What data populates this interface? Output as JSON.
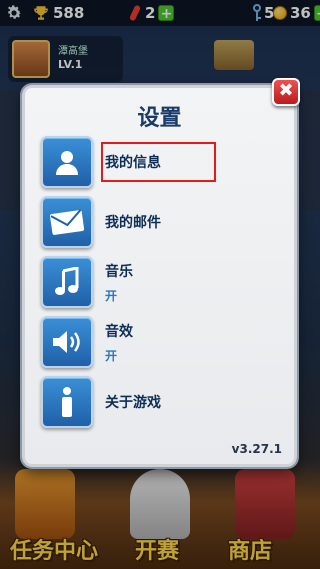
{
  "hud": {
    "trophies": "588",
    "boards": "2",
    "keys": "5",
    "coins": "36",
    "plus": "+"
  },
  "background": {
    "profile_name": "潭高堡",
    "profile_level": "LV.1",
    "bottom_buttons": [
      "任务中心",
      "开赛",
      "商店"
    ]
  },
  "dialog": {
    "title": "设置",
    "close": "✖",
    "items": [
      {
        "label": "我的信息",
        "icon": "person-icon"
      },
      {
        "label": "我的邮件",
        "icon": "mail-icon"
      },
      {
        "label": "音乐",
        "sub": "开",
        "icon": "music-note-icon"
      },
      {
        "label": "音效",
        "sub": "开",
        "icon": "speaker-icon"
      },
      {
        "label": "关于游戏",
        "icon": "info-icon"
      }
    ],
    "version": "v3.27.1"
  },
  "colors": {
    "icon_button": "#2f7cc4",
    "highlight": "#e41b1b",
    "title": "#1a3a6a"
  }
}
